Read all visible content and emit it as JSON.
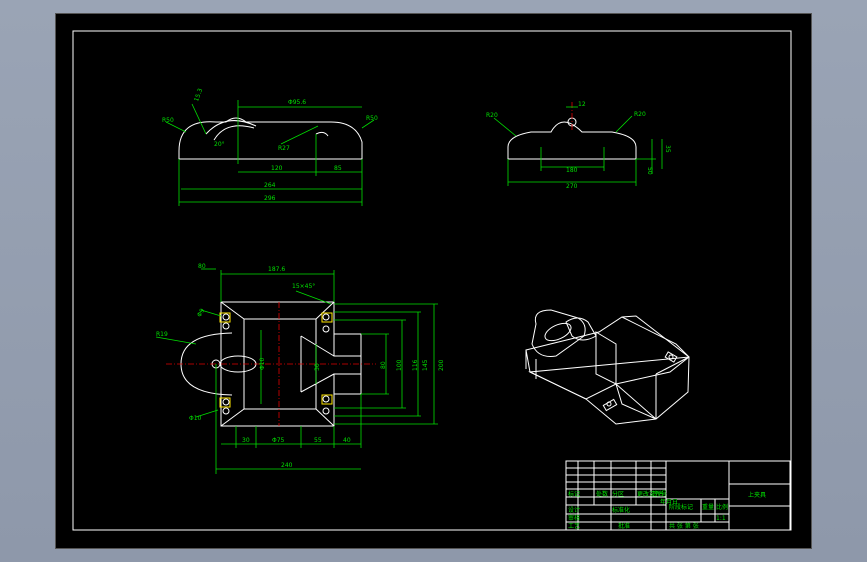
{
  "colors": {
    "paper": "#000000",
    "outline": "#ffffff",
    "dimension": "#00e000",
    "center": "#e00000",
    "detail": "#ffe600"
  },
  "front_view": {
    "angle": "15.3",
    "r_left": "R50",
    "diameter": "Φ95.6",
    "r_right": "R50",
    "angle_deg": "20°",
    "inner_r": "R27",
    "w_mid": "120",
    "w_right": "85",
    "w_mid2": "264",
    "w_total": "296"
  },
  "side_view": {
    "r_left": "R20",
    "width_top": "12",
    "r_right": "R20",
    "h_right": "35",
    "h_right2": "50",
    "w_inner": "180",
    "w_total": "270"
  },
  "plan_view": {
    "offset": "80",
    "width_top": "187.6",
    "chamfer": "15×45°",
    "r_left": "R19",
    "hole_r_top": "Φ9",
    "diameter_center": "Φ10",
    "hole_r_bottom": "Φ10",
    "v1": "80",
    "v2": "100",
    "v3": "116",
    "v4": "145",
    "v5": "200",
    "w1": "30",
    "w2": "Φ75",
    "w3": "55",
    "w4": "40",
    "w_total": "240",
    "v_mid": "30"
  },
  "title_block": {
    "name": "上夹具",
    "scale": "1:1",
    "row1": [
      "标记",
      "处数",
      "分区",
      "更改文件号",
      "签名",
      "年月日"
    ],
    "labels": [
      "设计",
      "审核",
      "工艺",
      "批准"
    ],
    "mid1": "标准化",
    "mid2": "阶段标记",
    "mid3": "重量",
    "mid4": "比例",
    "sheet": "共 张 第 张"
  }
}
